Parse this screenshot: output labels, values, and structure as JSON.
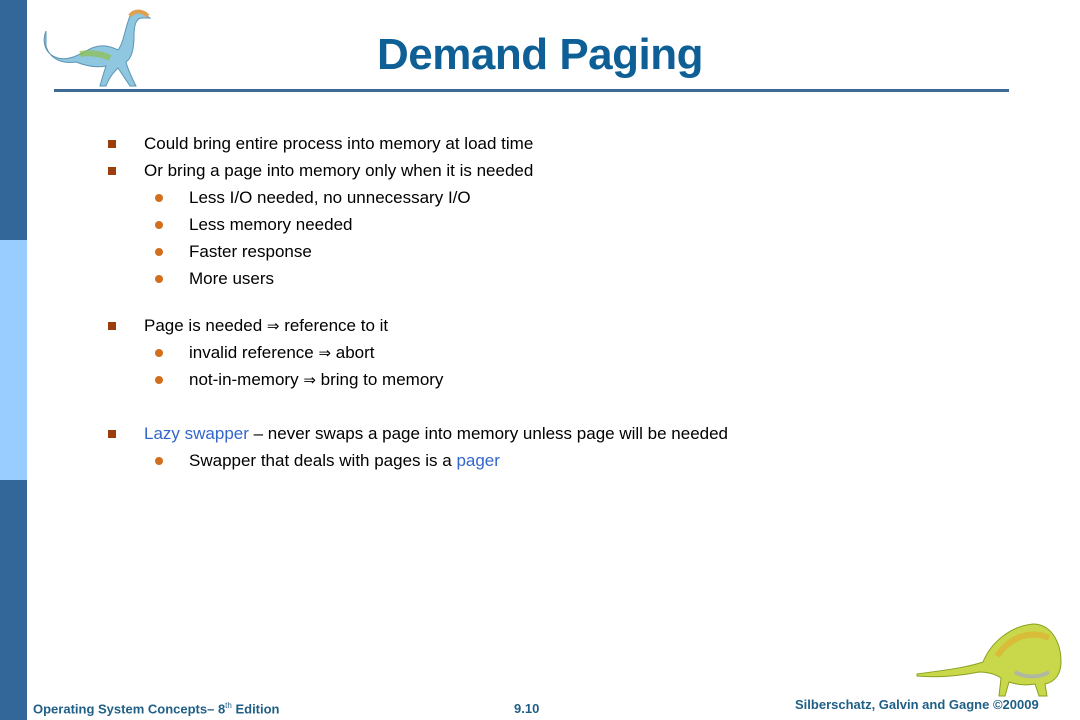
{
  "slide": {
    "title": "Demand Paging",
    "bullets": [
      {
        "text": "Could bring entire process into memory at load time"
      },
      {
        "text": "Or bring a page into memory only when it is needed",
        "sub": [
          "Less I/O needed, no unnecessary I/O",
          "Less memory needed",
          "Faster response",
          "More users"
        ]
      },
      {
        "pre": "Page is needed ",
        "arrow": "⇒",
        "post": " reference to it",
        "sub": [
          {
            "pre": "invalid reference ",
            "arrow": "⇒",
            "post": " abort"
          },
          {
            "pre": "not-in-memory ",
            "arrow": "⇒",
            "post": " bring to memory"
          }
        ]
      },
      {
        "highlight": "Lazy swapper",
        "post": " – never swaps a page into memory unless page will be needed",
        "sub": [
          {
            "pre": "Swapper that deals with pages is a ",
            "highlight": "pager"
          }
        ]
      }
    ]
  },
  "footer": {
    "book": "Operating System Concepts– 8",
    "book_sup": "th",
    "book_tail": " Edition",
    "page": "9.10",
    "copyright": "Silberschatz, Galvin and Gagne ©20009"
  },
  "icons": {
    "top_left": "dinosaur-icon",
    "bottom_right": "dinosaur-icon"
  },
  "colors": {
    "title": "#0d5f96",
    "sidebar_dark": "#336699",
    "sidebar_light": "#99ccff",
    "bullet_square": "#9c3d0c",
    "bullet_dot": "#d26f1e",
    "highlight": "#3366cc"
  }
}
